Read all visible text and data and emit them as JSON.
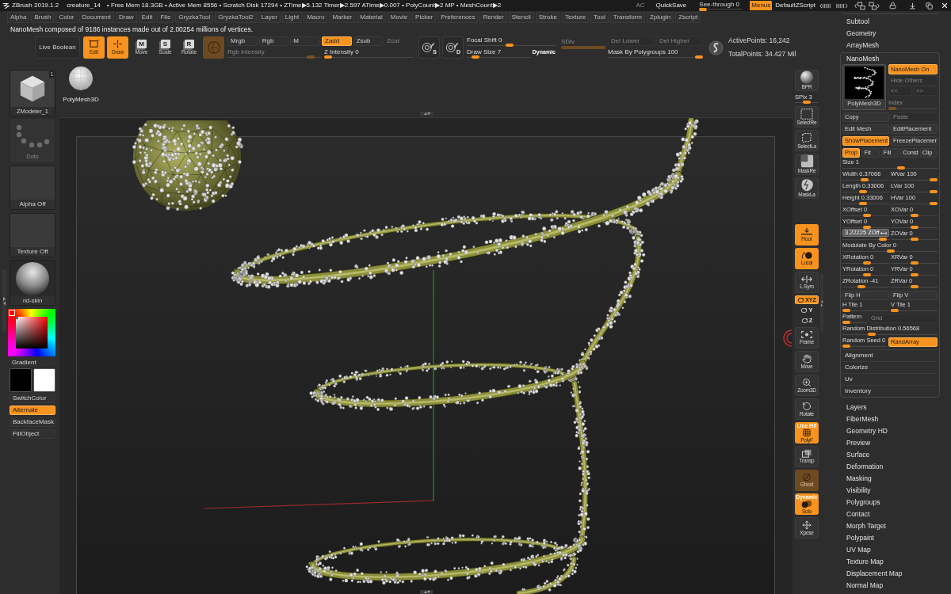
{
  "title_bar": {
    "app_name": "ZBrush 2019.1.2",
    "document": "creature_14",
    "stats": "• Free Mem 18.3GB • Active Mem 8556 • Scratch Disk 17294 • ZTime▶5.132 Timer▶2.597 ATime▶0.007 • PolyCount▶2 MP • MeshCount▶2",
    "ac": "AC",
    "quicksave": "QuickSave",
    "see_through": {
      "label": "See-through 0",
      "level": 0
    },
    "menus": {
      "label": "Menus",
      "selected": true
    },
    "script": "DefaultZScript"
  },
  "menu_bar": [
    "Alpha",
    "Brush",
    "Color",
    "Document",
    "Draw",
    "Edit",
    "File",
    "GryzkaTool",
    "GryzkaTool2",
    "Layer",
    "Light",
    "Macro",
    "Marker",
    "Material",
    "Movie",
    "Picker",
    "Preferences",
    "Render",
    "Stencil",
    "Stroke",
    "Texture",
    "Tool",
    "Transform",
    "Zplugin",
    "Zscript"
  ],
  "message": "NanoMesh composed of 9186 instances made out of 2.00254 millions of vertices.",
  "toolbar": {
    "live_boolean": {
      "label": "Live Boolean",
      "selected": false
    },
    "transform_modes": [
      {
        "label": "Edit",
        "selected": true
      },
      {
        "label": "Draw",
        "selected": true
      },
      {
        "label": "Move",
        "letter": "M",
        "selected": false
      },
      {
        "label": "Scale",
        "letter": "S",
        "selected": false
      },
      {
        "label": "Rotate",
        "letter": "R",
        "selected": false
      }
    ],
    "paint_modes": [
      {
        "label": "Mrgb",
        "selected": false,
        "disabled": false
      },
      {
        "label": "Rgb",
        "selected": false,
        "disabled": false
      },
      {
        "label": "M",
        "selected": false,
        "disabled": false
      },
      {
        "label": "Zadd",
        "selected": true,
        "disabled": false
      },
      {
        "label": "Zsub",
        "selected": false,
        "disabled": false
      },
      {
        "label": "Zcut",
        "selected": false,
        "disabled": true
      }
    ],
    "rgb_intensity": {
      "label": "Rgb Intensity",
      "disabled": true,
      "level": 0.93
    },
    "z_intensity": {
      "label": "Z Intensity 0",
      "disabled": false,
      "level": 0
    },
    "stroke_options": [
      {
        "letter": "S"
      },
      {
        "letter": "D"
      }
    ],
    "focal_shift": {
      "label": "Focal Shift 0",
      "level": 0.48
    },
    "draw_size": {
      "label": "Draw Size 7",
      "level": 0.08
    },
    "dynamic": {
      "label": "Dynamic"
    },
    "sdiv": {
      "label": "SDiv",
      "disabled": true
    },
    "del_buttons": [
      {
        "label": "Del Lower",
        "disabled": true
      },
      {
        "label": "Del Higher",
        "disabled": true
      }
    ],
    "mask_by_polygroups": {
      "label": "Mask By Polygroups 100",
      "level": 1
    },
    "points": [
      "ActivePoints: 16,242",
      "TotalPoints: 34.427 Mil"
    ]
  },
  "left_tray": {
    "tool": {
      "label": "ZModeler_1",
      "badge": "1"
    },
    "stroke": {
      "label": "Dots",
      "disabled": true
    },
    "alpha": {
      "label": "Alpha Off"
    },
    "texture": {
      "label": "Texture Off"
    },
    "material": {
      "label": "nd-skin"
    },
    "gradient": {
      "label": "Gradient",
      "selected": false
    },
    "swatches": [
      {
        "color": "#000000"
      },
      {
        "color": "#ffffff"
      }
    ],
    "buttons": [
      {
        "label": "SwitchColor",
        "selected": false
      },
      {
        "label": "Alternate",
        "selected": true
      },
      {
        "label": "BackfaceMask",
        "selected": false
      },
      {
        "label": "FillObject",
        "selected": false
      }
    ]
  },
  "subtool_thumbnail": {
    "label": "PolyMesh3D"
  },
  "shelf": {
    "top": [
      {
        "kind": "button",
        "label": "BPR",
        "selected": false
      },
      {
        "kind": "slider",
        "label": "SPix 3",
        "level": 0.5
      },
      {
        "kind": "button",
        "label": "SelectRe",
        "selected": false
      },
      {
        "kind": "button",
        "label": "SelectLa",
        "selected": false
      },
      {
        "kind": "button",
        "label": "MaskRe",
        "selected": false
      },
      {
        "kind": "button",
        "label": "MaskLa",
        "selected": false
      }
    ],
    "bottom": [
      {
        "kind": "button",
        "label": "Floor",
        "selected": true,
        "disabled": false
      },
      {
        "kind": "button",
        "label": "Local",
        "selected": true,
        "disabled": false
      },
      {
        "kind": "button",
        "label": "L.Sym",
        "selected": false,
        "disabled": false
      },
      {
        "kind": "pill",
        "label": "XYZ",
        "selected": true,
        "disabled": false
      },
      {
        "kind": "mini",
        "label": "Y",
        "selected": false,
        "disabled": false
      },
      {
        "kind": "mini",
        "label": "Z",
        "selected": false,
        "disabled": false
      },
      {
        "kind": "button",
        "label": "Frame",
        "selected": false,
        "disabled": false
      },
      {
        "kind": "button",
        "label": "Move",
        "selected": false,
        "disabled": false
      },
      {
        "kind": "button",
        "label": "Zoom3D",
        "selected": false,
        "disabled": false
      },
      {
        "kind": "button",
        "label": "Rotate",
        "selected": false,
        "disabled": false
      },
      {
        "kind": "button",
        "label": "PolyF",
        "caption": "Line Fill",
        "selected": true,
        "disabled": false
      },
      {
        "kind": "button",
        "label": "Transp",
        "selected": false,
        "disabled": false
      },
      {
        "kind": "button",
        "label": "Ghost",
        "selected": true,
        "disabled": true
      },
      {
        "kind": "button",
        "label": "Solo",
        "caption": "Dynamic",
        "selected": true,
        "disabled": false
      },
      {
        "kind": "button",
        "label": "Xpose",
        "selected": false,
        "disabled": false
      }
    ]
  },
  "tool_palette": {
    "sections_above": [
      "Subtool",
      "Geometry",
      "ArrayMesh"
    ],
    "nanomesh": {
      "title": "NanoMesh",
      "thumbnail_label": "PolyMesh3D",
      "side": [
        {
          "kind": "button",
          "label": "NanoMesh On",
          "selected": true,
          "disabled": false
        },
        {
          "kind": "button",
          "label": "Hide Others",
          "selected": false,
          "disabled": true
        },
        {
          "kind": "pair",
          "items": [
            {
              "label": "<<",
              "disabled": true
            },
            {
              "label": ">>",
              "disabled": true
            }
          ]
        },
        {
          "kind": "slider",
          "label": "Index",
          "disabled": true,
          "level": 0
        }
      ],
      "button_rows": [
        [
          {
            "label": "Copy",
            "selected": false,
            "disabled": false
          },
          {
            "label": "Paste",
            "selected": false,
            "disabled": true
          }
        ],
        [
          {
            "label": "Edit Mesh",
            "selected": false,
            "disabled": false
          },
          {
            "label": "EditPlacement",
            "selected": false,
            "disabled": false
          }
        ],
        [
          {
            "label": "ShowPlacement",
            "selected": true,
            "disabled": false
          },
          {
            "label": "FreezePlacemer",
            "selected": false,
            "disabled": false
          }
        ]
      ],
      "tabs": [
        {
          "label": "Prop",
          "selected": true
        },
        {
          "label": "Fit",
          "selected": false
        },
        {
          "label": "Fill",
          "selected": false
        },
        {
          "label": "Const",
          "selected": false
        },
        {
          "label": "Clip",
          "selected": false
        }
      ],
      "rows": [
        [
          {
            "kind": "slider",
            "label": "Size 1",
            "level": 0.63
          }
        ],
        [
          {
            "kind": "slider",
            "label": "Width 0.37066",
            "level": 0.46
          },
          {
            "kind": "slider",
            "label": "WVar 100",
            "level": 1
          }
        ],
        [
          {
            "kind": "slider",
            "label": "Length 0.33006",
            "level": 0.43
          },
          {
            "kind": "slider",
            "label": "LVar 100",
            "level": 1
          }
        ],
        [
          {
            "kind": "slider",
            "label": "Height 0.33006",
            "level": 0.43
          },
          {
            "kind": "slider",
            "label": "HVar 100",
            "level": 1
          }
        ],
        [
          {
            "kind": "slider",
            "label": "XOffset 0",
            "level": 0.54
          },
          {
            "kind": "slider",
            "label": "XOVar 0",
            "level": 0.52
          }
        ],
        [
          {
            "kind": "slider",
            "label": "YOffset 0",
            "level": 0.54
          },
          {
            "kind": "slider",
            "label": "YOVar 0",
            "level": 0.52
          }
        ],
        [
          {
            "kind": "editing",
            "value": "3.22225 ZOff",
            "level": 0.93
          },
          {
            "kind": "slider",
            "label": "ZOVar 0",
            "level": 0.52
          }
        ],
        [
          {
            "kind": "slider",
            "label": "Modulate By Color 0",
            "level": 0.51
          }
        ],
        [
          {
            "kind": "slider",
            "label": "XRotation 0",
            "level": 0.54
          },
          {
            "kind": "slider",
            "label": "XRVar 0",
            "level": 0.52
          }
        ],
        [
          {
            "kind": "slider",
            "label": "YRotation 0",
            "level": 0.54
          },
          {
            "kind": "slider",
            "label": "YRVar 0",
            "level": 0.52
          }
        ],
        [
          {
            "kind": "slider",
            "label": "ZRotation -41",
            "level": 0.39
          },
          {
            "kind": "slider",
            "label": "ZRVar 0",
            "level": 0.52
          }
        ],
        [
          {
            "kind": "button",
            "label": "Flip H",
            "selected": false,
            "disabled": false
          },
          {
            "kind": "button",
            "label": "Flip V",
            "selected": false,
            "disabled": false
          }
        ],
        [
          {
            "kind": "slider",
            "label": "H Tile 1",
            "level": 0
          },
          {
            "kind": "slider",
            "label": "V Tile 1",
            "level": 0
          }
        ],
        [
          {
            "kind": "short_slider",
            "label": "Pattern",
            "level": 0
          },
          {
            "kind": "button",
            "label": "Grid",
            "selected": false,
            "disabled": true
          }
        ],
        [
          {
            "kind": "slider",
            "label": "Random Distribution 0.56568",
            "level": 0.29
          }
        ],
        [
          {
            "kind": "slider",
            "label": "Random Seed 0",
            "level": 0
          },
          {
            "kind": "button",
            "label": "RandArray",
            "selected": true,
            "disabled": false
          }
        ]
      ],
      "subsections": [
        "Alignment",
        "Colorize",
        "Uv",
        "Inventory"
      ]
    },
    "sections_below": [
      "Layers",
      "FiberMesh",
      "Geometry HD",
      "Preview",
      "Surface",
      "Deformation",
      "Masking",
      "Visibility",
      "Polygroups",
      "Contact",
      "Morph Target",
      "Polypaint",
      "UV Map",
      "Texture Map",
      "Displacement Map",
      "Normal Map"
    ]
  }
}
